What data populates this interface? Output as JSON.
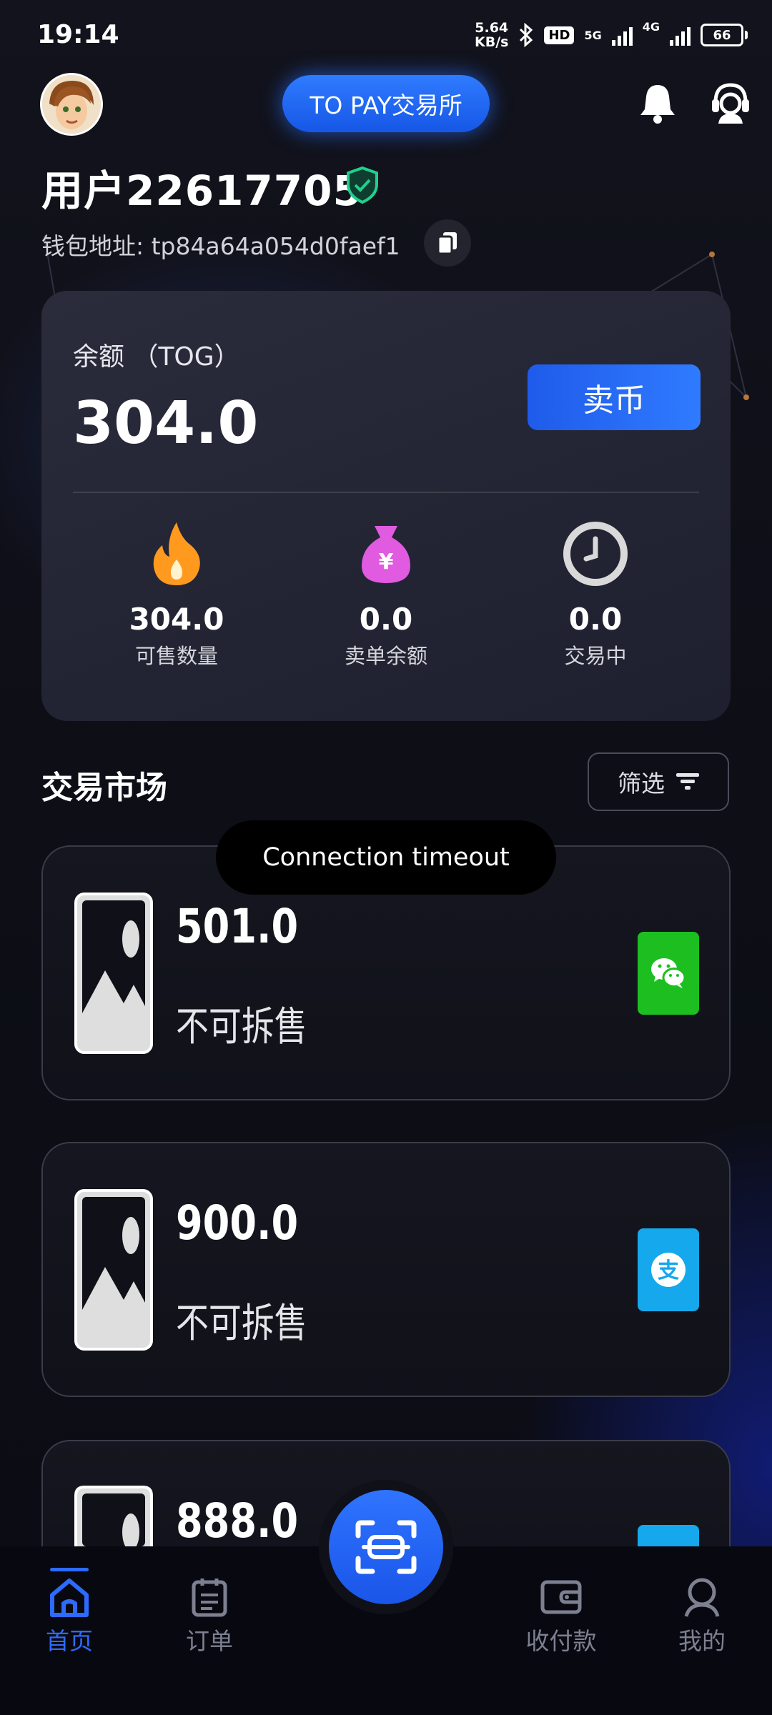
{
  "status_bar": {
    "time": "19:14",
    "net_speed_value": "5.64",
    "net_speed_unit": "KB/s",
    "hd": "HD",
    "net_5g": "5G",
    "net_4g": "4G",
    "battery": "66"
  },
  "header": {
    "exchange_label": "TO PAY交易所",
    "user_name": "用户22617705",
    "wallet_label": "钱包地址: tp84a64a054d0faef1"
  },
  "balance_card": {
    "label": "余额 （TOG）",
    "value": "304.0",
    "sell_button": "卖币",
    "stats": [
      {
        "icon": "fire-icon",
        "value": "304.0",
        "label": "可售数量"
      },
      {
        "icon": "money-bag-icon",
        "value": "0.0",
        "label": "卖单余额"
      },
      {
        "icon": "clock-icon",
        "value": "0.0",
        "label": "交易中"
      }
    ]
  },
  "market": {
    "title": "交易市场",
    "filter_label": "筛选",
    "listings": [
      {
        "amount": "501.0",
        "note": "不可拆售",
        "payment": "wechat-pay-icon",
        "color": "#1dbf20"
      },
      {
        "amount": "900.0",
        "note": "不可拆售",
        "payment": "alipay-icon",
        "color": "#15a8ec"
      },
      {
        "amount": "888.0",
        "note": "",
        "payment": "alipay-icon",
        "color": "#15a8ec"
      }
    ]
  },
  "toast": "Connection timeout",
  "bottom_nav": {
    "items": [
      {
        "label": "首页",
        "icon": "home-icon",
        "active": true
      },
      {
        "label": "订单",
        "icon": "clipboard-icon",
        "active": false
      },
      {
        "label": "收付款",
        "icon": "wallet-icon",
        "active": false
      },
      {
        "label": "我的",
        "icon": "profile-icon",
        "active": false
      }
    ],
    "center_action": "scan-icon"
  },
  "colors": {
    "accent": "#2d6bff",
    "background": "#0c0d14",
    "card": "#252737",
    "wechat": "#1dbf20",
    "alipay": "#15a8ec"
  }
}
